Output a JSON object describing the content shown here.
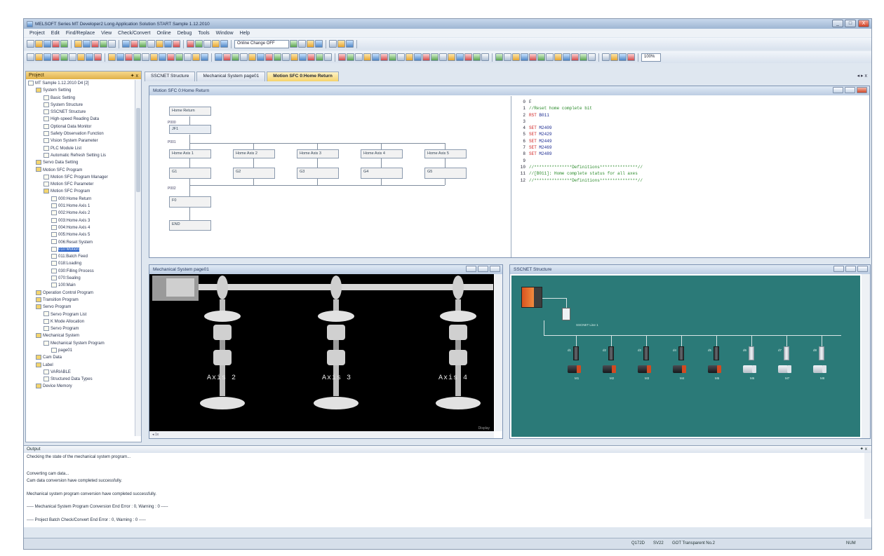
{
  "window": {
    "title": "MELSOFT Series MT Developer2 Long Application Solution START Sample 1.12.2010",
    "controls": [
      "_",
      "□",
      "X"
    ]
  },
  "menu": [
    "Project",
    "Edit",
    "Find/Replace",
    "View",
    "Check/Convert",
    "Online",
    "Debug",
    "Tools",
    "Window",
    "Help"
  ],
  "toolbar": {
    "online_change": "Online Change OFF",
    "zoom": "100%"
  },
  "project_pane": {
    "title": "Project",
    "pin": "✦ x",
    "tree": [
      {
        "label": "MT Sample 1.12.2010 D4 [2]",
        "indent": 0,
        "icon": "project-icon"
      },
      {
        "label": "System Setting",
        "indent": 1,
        "icon": "folder-icon"
      },
      {
        "label": "Basic Setting",
        "indent": 2,
        "icon": "settings-icon"
      },
      {
        "label": "System Structure",
        "indent": 2,
        "icon": "structure-icon"
      },
      {
        "label": "SSCNET Structure",
        "indent": 2,
        "icon": "network-icon"
      },
      {
        "label": "High-speed Reading Data",
        "indent": 2,
        "icon": "data-icon"
      },
      {
        "label": "Optional Data Monitor",
        "indent": 2,
        "icon": "monitor-icon"
      },
      {
        "label": "Safety Observation Function",
        "indent": 2,
        "icon": "shield-icon"
      },
      {
        "label": "Vision System Parameter",
        "indent": 2,
        "icon": "camera-icon"
      },
      {
        "label": "PLC Module List",
        "indent": 2,
        "icon": "list-icon"
      },
      {
        "label": "Automatic Refresh Setting Lis",
        "indent": 2,
        "icon": "refresh-icon"
      },
      {
        "label": "Servo Data Setting",
        "indent": 1,
        "icon": "folder-icon"
      },
      {
        "label": "Motion SFC Program",
        "indent": 1,
        "icon": "folder-icon"
      },
      {
        "label": "Motion SFC Program Manager",
        "indent": 2,
        "icon": "program-icon"
      },
      {
        "label": "Motion SFC Parameter",
        "indent": 2,
        "icon": "parameter-icon"
      },
      {
        "label": "Motion SFC Program",
        "indent": 2,
        "icon": "folder-icon"
      },
      {
        "label": "000:Home Return",
        "indent": 3,
        "icon": "file-icon"
      },
      {
        "label": "001:Home Axis 1",
        "indent": 3,
        "icon": "file-icon"
      },
      {
        "label": "002:Home Axis 2",
        "indent": 3,
        "icon": "file-icon"
      },
      {
        "label": "003:Home Axis 3",
        "indent": 3,
        "icon": "file-icon"
      },
      {
        "label": "004:Home Axis 4",
        "indent": 3,
        "icon": "file-icon"
      },
      {
        "label": "005:Home Axis 5",
        "indent": 3,
        "icon": "file-icon"
      },
      {
        "label": "006:Reset System",
        "indent": 3,
        "icon": "file-icon"
      },
      {
        "label": "010:Motion",
        "indent": 3,
        "icon": "file-icon",
        "selected": true
      },
      {
        "label": "011:Batch Feed",
        "indent": 3,
        "icon": "file-icon"
      },
      {
        "label": "018:Loading",
        "indent": 3,
        "icon": "file-icon"
      },
      {
        "label": "030:Filling Process",
        "indent": 3,
        "icon": "file-icon"
      },
      {
        "label": "070:Sealing",
        "indent": 3,
        "icon": "file-icon"
      },
      {
        "label": "100:Main",
        "indent": 3,
        "icon": "file-icon"
      },
      {
        "label": "Operation Control Program",
        "indent": 1,
        "icon": "folder-icon"
      },
      {
        "label": "Transition Program",
        "indent": 1,
        "icon": "folder-icon"
      },
      {
        "label": "Servo Program",
        "indent": 1,
        "icon": "folder-icon"
      },
      {
        "label": "Servo Program List",
        "indent": 2,
        "icon": "list-icon"
      },
      {
        "label": "K Mode Allocation",
        "indent": 2,
        "icon": "data-icon"
      },
      {
        "label": "Servo Program",
        "indent": 2,
        "icon": "program-icon"
      },
      {
        "label": "Mechanical System",
        "indent": 1,
        "icon": "folder-icon"
      },
      {
        "label": "Mechanical System Program",
        "indent": 2,
        "icon": "program-icon"
      },
      {
        "label": "page01",
        "indent": 3,
        "icon": "file-icon"
      },
      {
        "label": "Cam Data",
        "indent": 1,
        "icon": "folder-icon"
      },
      {
        "label": "Label",
        "indent": 1,
        "icon": "folder-icon"
      },
      {
        "label": "VARIABLE",
        "indent": 2,
        "icon": "variable-icon"
      },
      {
        "label": "Structured Data Types",
        "indent": 2,
        "icon": "data-icon"
      },
      {
        "label": "Device Memory",
        "indent": 1,
        "icon": "folder-icon"
      }
    ]
  },
  "tabs": [
    {
      "label": "SSCNET Structure",
      "active": false
    },
    {
      "label": "Mechanical System page01",
      "active": false
    },
    {
      "label": "Motion SFC 0:Home Return",
      "active": true
    }
  ],
  "tab_controls": "◂ ▸ x",
  "sfc_window": {
    "title": "Motion SFC 0:Home Return",
    "start": "Home Return",
    "step1": "JF1",
    "step1_label": "P000",
    "branch_label": "P001",
    "axes": [
      "Home Axis 1",
      "Home Axis 2",
      "Home Axis 3",
      "Home Axis 4",
      "Home Axis 5"
    ],
    "g_steps": [
      "G1",
      "G2",
      "G3",
      "G4",
      "G5"
    ],
    "merge_label": "P002",
    "f_step": "F0",
    "end": "END"
  },
  "code": {
    "header": [
      "0",
      "F"
    ],
    "lines": [
      {
        "n": "1",
        "kind": "comment",
        "text": "//Reset home complete bit"
      },
      {
        "n": "2",
        "kind": "kw",
        "kw": "RST",
        "text": " B011"
      },
      {
        "n": "3",
        "kind": "blank",
        "text": ""
      },
      {
        "n": "4",
        "kind": "kw",
        "kw": "SET",
        "text": " M2409"
      },
      {
        "n": "5",
        "kind": "kw",
        "kw": "SET",
        "text": " M2429"
      },
      {
        "n": "6",
        "kind": "kw",
        "kw": "SET",
        "text": " M2449"
      },
      {
        "n": "7",
        "kind": "kw",
        "kw": "SET",
        "text": " M2469"
      },
      {
        "n": "8",
        "kind": "kw",
        "kw": "SET",
        "text": " M2489"
      },
      {
        "n": "9",
        "kind": "blank",
        "text": ""
      },
      {
        "n": "10",
        "kind": "comment",
        "text": "//***************Definitions***************//"
      },
      {
        "n": "11",
        "kind": "comment",
        "text": "//[B011]: Home complete status for all axes"
      },
      {
        "n": "12",
        "kind": "comment",
        "text": "//***************Definitions***************//"
      }
    ]
  },
  "mech_window": {
    "title": "Mechanical System page01",
    "axis_labels": [
      "Axis 2",
      "Axis 3",
      "Axis 4"
    ],
    "hscroll": "◂ 1x",
    "footer": "Display"
  },
  "sscnet_window": {
    "title": "SSCNET Structure",
    "line_label": "SSCNET Line 1",
    "amp_labels": [
      "d1",
      "d2",
      "d3",
      "d4",
      "d5",
      "d6",
      "d7",
      "d8"
    ],
    "motor_labels": [
      "M1",
      "M2",
      "M3",
      "M4",
      "M5",
      "M6",
      "M7",
      "M8"
    ]
  },
  "output": {
    "title": "Output",
    "pin": "✦ x",
    "lines": [
      "Checking the state of the mechanical system program...",
      "Converting cam data...",
      "Cam data conversion have completed successfully.",
      "Mechanical system program conversion have completed successfully.",
      "----- Mechanical System Program Conversion End  Error : 0, Warning : 0 -----",
      "----- Project Batch Check/Convert  End Error : 0, Warning : 0 -----"
    ]
  },
  "status": {
    "cpu": "Q172D",
    "mode": "SV22",
    "connection": "GOT Transparent No.2",
    "caps": "NUM"
  }
}
